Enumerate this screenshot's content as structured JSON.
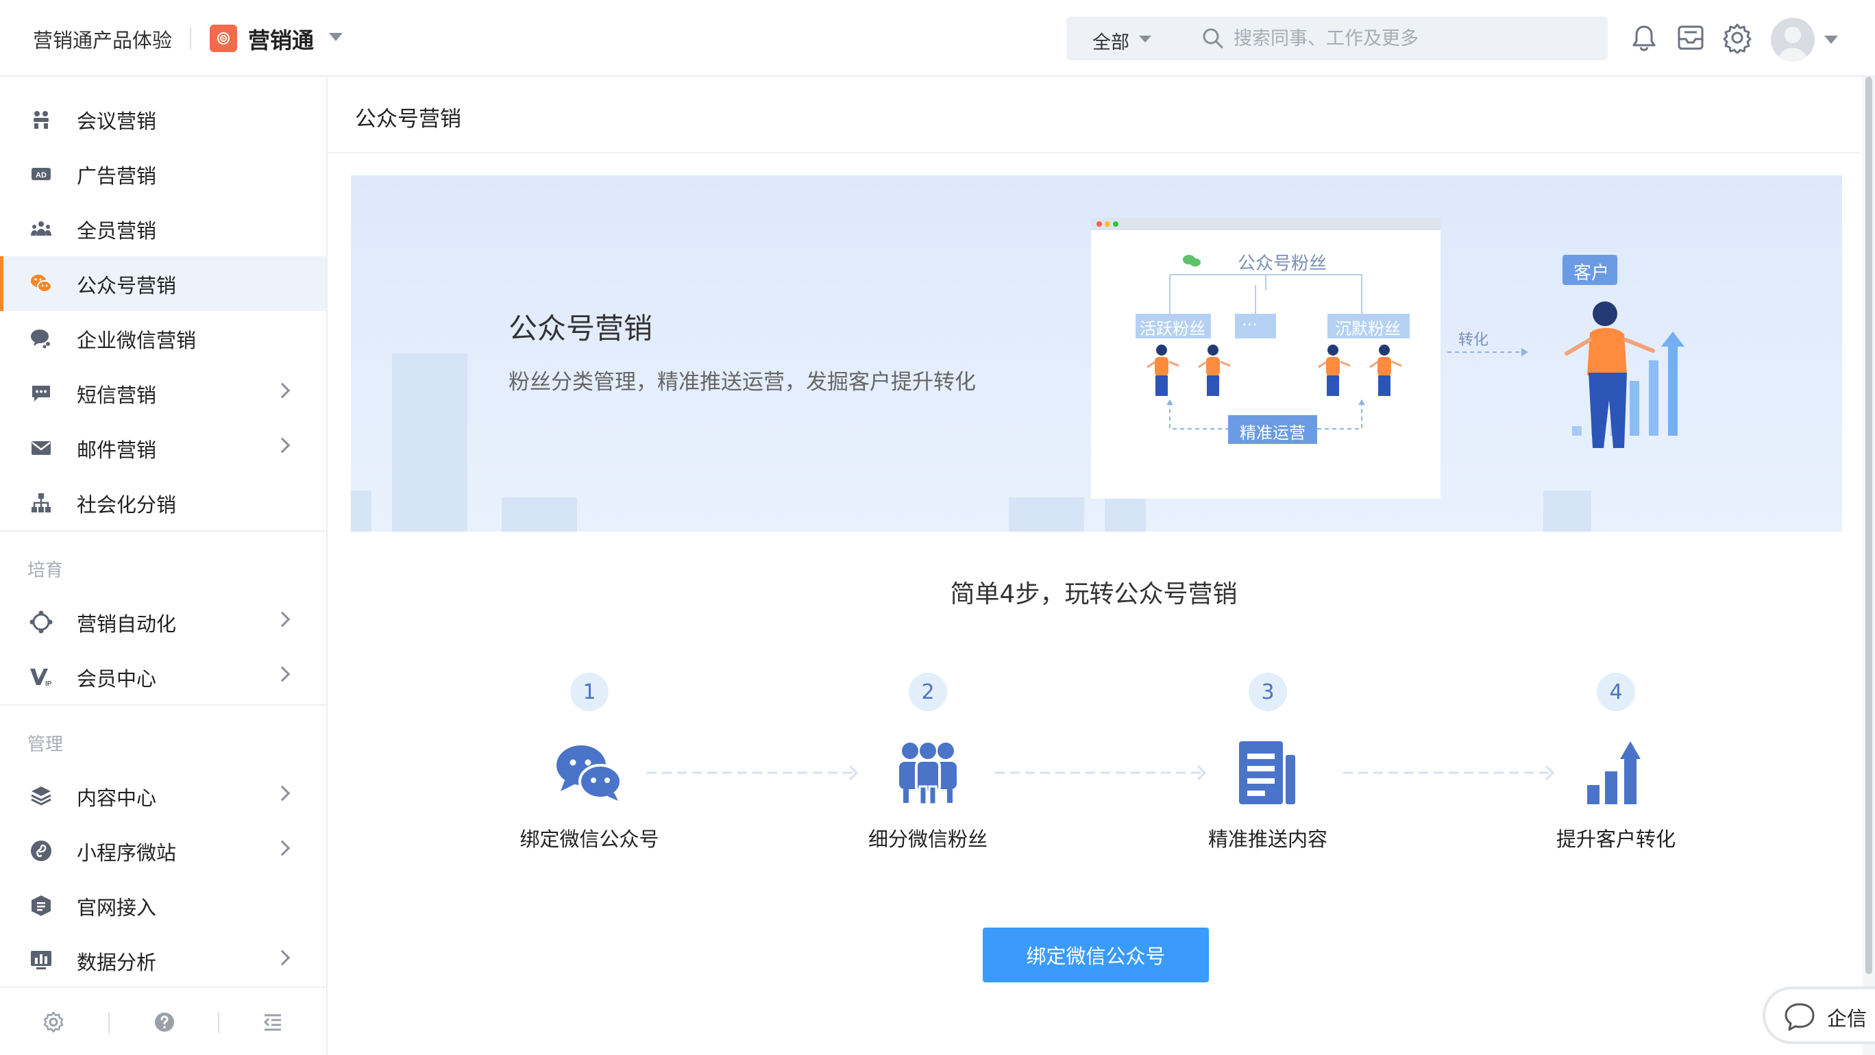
{
  "header": {
    "trial_label": "营销通产品体验",
    "app_name": "营销通",
    "search_scope": "全部",
    "search_placeholder": "搜索同事、工作及更多"
  },
  "sidebar": {
    "items": [
      {
        "label": "会议营销",
        "icon": "meeting-icon"
      },
      {
        "label": "广告营销",
        "icon": "ad-icon"
      },
      {
        "label": "全员营销",
        "icon": "team-icon"
      },
      {
        "label": "公众号营销",
        "icon": "wechat-icon",
        "active": true
      },
      {
        "label": "企业微信营销",
        "icon": "work-wechat-icon"
      },
      {
        "label": "短信营销",
        "icon": "sms-icon",
        "expandable": true
      },
      {
        "label": "邮件营销",
        "icon": "mail-icon",
        "expandable": true
      },
      {
        "label": "社会化分销",
        "icon": "org-tree-icon"
      }
    ],
    "section_nurture": "培育",
    "nurture_items": [
      {
        "label": "营销自动化",
        "icon": "automation-icon",
        "expandable": true
      },
      {
        "label": "会员中心",
        "icon": "vip-icon",
        "expandable": true
      }
    ],
    "section_manage": "管理",
    "manage_items": [
      {
        "label": "内容中心",
        "icon": "layers-icon",
        "expandable": true
      },
      {
        "label": "小程序微站",
        "icon": "miniprogram-icon",
        "expandable": true
      },
      {
        "label": "官网接入",
        "icon": "website-icon"
      },
      {
        "label": "数据分析",
        "icon": "chart-icon",
        "expandable": true
      }
    ]
  },
  "main": {
    "page_title": "公众号营销",
    "banner": {
      "title": "公众号营销",
      "subtitle": "粉丝分类管理，精准推送运营，发掘客户提升转化",
      "illus_fans": "公众号粉丝",
      "illus_active": "活跃粉丝",
      "illus_more": "···",
      "illus_silent": "沉默粉丝",
      "illus_precise": "精准运营",
      "illus_convert": "转化",
      "illus_customer": "客户"
    },
    "steps_title": "简单4步，玩转公众号营销",
    "steps": [
      {
        "num": "1",
        "label": "绑定微信公众号"
      },
      {
        "num": "2",
        "label": "细分微信粉丝"
      },
      {
        "num": "3",
        "label": "精准推送内容"
      },
      {
        "num": "4",
        "label": "提升客户转化"
      }
    ],
    "bind_button": "绑定微信公众号"
  },
  "float_chat": {
    "label": "企信"
  },
  "colors": {
    "accent": "#3a9bfd",
    "active_marker": "#f5862a",
    "icon_blue": "#4a74c8",
    "brand_logo": "#f26b4b"
  }
}
